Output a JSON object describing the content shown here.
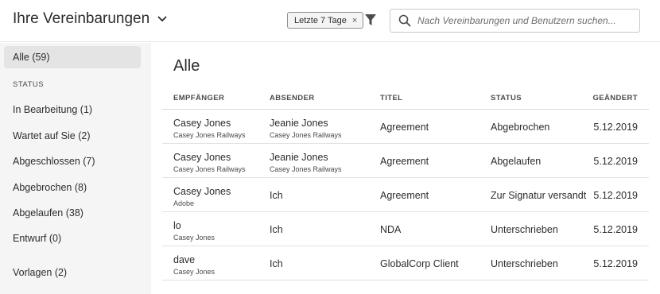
{
  "header": {
    "title": "Ihre Vereinbarungen",
    "filter_tag": "Letzte 7 Tage",
    "filter_tag_remove": "×",
    "search_placeholder": "Nach Vereinbarungen und Benutzern suchen..."
  },
  "sidebar": {
    "all": "Alle (59)",
    "status_heading": "STATUS",
    "items": [
      "In Bearbeitung (1)",
      "Wartet auf Sie (2)",
      "Abgeschlossen (7)",
      "Abgebrochen (8)",
      "Abgelaufen (38)",
      "Entwurf (0)"
    ],
    "templates": "Vorlagen (2)"
  },
  "main": {
    "title": "Alle",
    "columns": [
      "EMPFÄNGER",
      "ABSENDER",
      "TITEL",
      "STATUS",
      "GEÄNDERT"
    ],
    "rows": [
      {
        "recipient": "Casey Jones",
        "recipient_sub": "Casey Jones Railways",
        "sender": "Jeanie Jones",
        "sender_sub": "Casey Jones Railways",
        "title": "Agreement",
        "status": "Abgebrochen",
        "changed": "5.12.2019"
      },
      {
        "recipient": "Casey Jones",
        "recipient_sub": "Casey Jones Railways",
        "sender": "Jeanie Jones",
        "sender_sub": "Casey Jones Railways",
        "title": "Agreement",
        "status": "Abgelaufen",
        "changed": "5.12.2019"
      },
      {
        "recipient": "Casey Jones",
        "recipient_sub": "Adobe",
        "sender": "Ich",
        "sender_sub": "",
        "title": "Agreement",
        "status": "Zur Signatur versandt",
        "changed": "5.12.2019"
      },
      {
        "recipient": "lo",
        "recipient_sub": "Casey Jones",
        "sender": "Ich",
        "sender_sub": "",
        "title": "NDA",
        "status": "Unterschrieben",
        "changed": "5.12.2019"
      },
      {
        "recipient": "dave",
        "recipient_sub": "Casey Jones",
        "sender": "Ich",
        "sender_sub": "",
        "title": "GlobalCorp Client",
        "status": "Unterschrieben",
        "changed": "5.12.2019"
      }
    ]
  },
  "icons": {
    "title_dropdown": "chevron-down-icon",
    "filter": "filter-icon",
    "search": "search-icon"
  }
}
